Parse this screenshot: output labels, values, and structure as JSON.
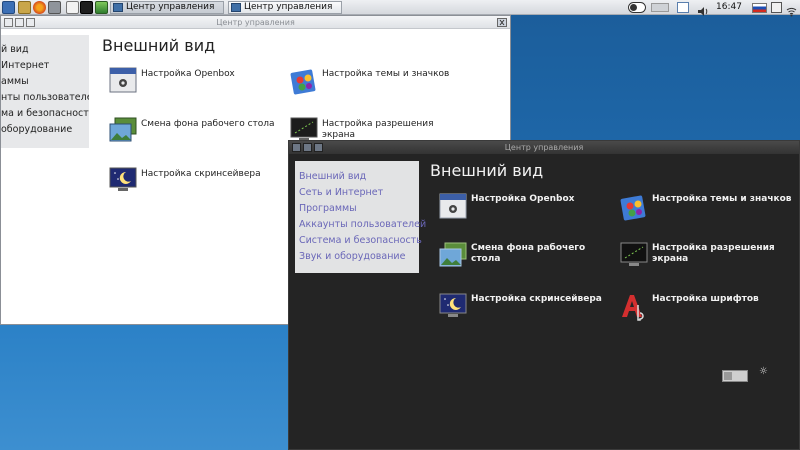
{
  "taskbar": {
    "tasks": [
      {
        "label": "Центр управления",
        "active": true
      },
      {
        "label": "Центр управления",
        "active": false
      }
    ],
    "clock": "16:47",
    "launchers": [
      "apps-menu-icon",
      "files-icon",
      "firefox-icon",
      "settings-icon",
      "editor-icon",
      "terminal-icon",
      "image-viewer-icon"
    ],
    "tray": [
      "switch-icon",
      "battery-icon",
      "window-icon",
      "volume-icon",
      "language-flag-icon",
      "keyboard-layout-icon",
      "wifi-icon"
    ]
  },
  "light_window": {
    "title": "Центр управления",
    "heading": "Внешний вид",
    "sidebar": [
      "й вид",
      "Интернет",
      "аммы",
      "нты пользователей",
      "ма и безопасность",
      "оборудование"
    ],
    "apps": [
      {
        "label": "Настройка Openbox",
        "icon": "openbox-icon"
      },
      {
        "label": "Настройка темы и значков",
        "icon": "theme-icon"
      },
      {
        "label": "Смена фона рабочего стола",
        "icon": "wallpaper-icon"
      },
      {
        "label": "Настройка разрешения экрана",
        "icon": "display-icon"
      },
      {
        "label": "Настройка скринсейвера",
        "icon": "screensaver-icon"
      }
    ]
  },
  "dark_window": {
    "title": "Центр управления",
    "heading": "Внешний вид",
    "sidebar": [
      "Внешний вид",
      "Сеть и Интернет",
      "Программы",
      "Аккаунты пользователей",
      "Система и безопасность",
      "Звук и оборудование"
    ],
    "apps": [
      {
        "label": "Настройка Openbox",
        "icon": "openbox-icon"
      },
      {
        "label": "Настройка темы и значков",
        "icon": "theme-icon"
      },
      {
        "label": "Смена фона рабочего стола",
        "icon": "wallpaper-icon"
      },
      {
        "label": "Настройка разрешения экрана",
        "icon": "display-icon"
      },
      {
        "label": "Настройка скринсейвера",
        "icon": "screensaver-icon"
      },
      {
        "label": "Настройка шрифтов",
        "icon": "fonts-icon"
      }
    ]
  },
  "colors": {
    "desktop_top": "#1b5d9a",
    "desktop_bottom": "#3d8fd0",
    "dark_window_bg": "#242424",
    "sidebar_link": "#6a67b8"
  }
}
